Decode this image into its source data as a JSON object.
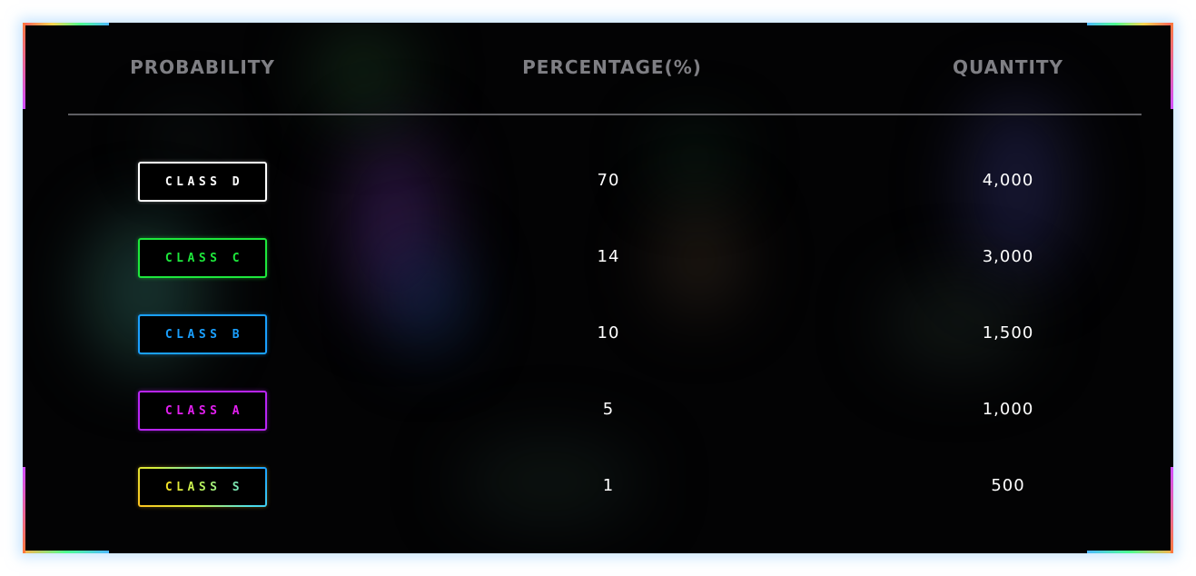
{
  "table": {
    "headers": {
      "probability": "PROBABILITY",
      "percentage": "PERCENTAGE(%)",
      "quantity": "QUANTITY"
    },
    "rows": [
      {
        "class_label": "CLASS D",
        "percentage": "70",
        "quantity": "4,000",
        "color": "#ffffff"
      },
      {
        "class_label": "CLASS C",
        "percentage": "14",
        "quantity": "3,000",
        "color": "#1ee83c"
      },
      {
        "class_label": "CLASS B",
        "percentage": "10",
        "quantity": "1,500",
        "color": "#1aa0ff"
      },
      {
        "class_label": "CLASS A",
        "percentage": "5",
        "quantity": "1,000",
        "color": "#d41ff0"
      },
      {
        "class_label": "CLASS S",
        "percentage": "1",
        "quantity": "500",
        "color": "#ffd21e"
      }
    ]
  }
}
